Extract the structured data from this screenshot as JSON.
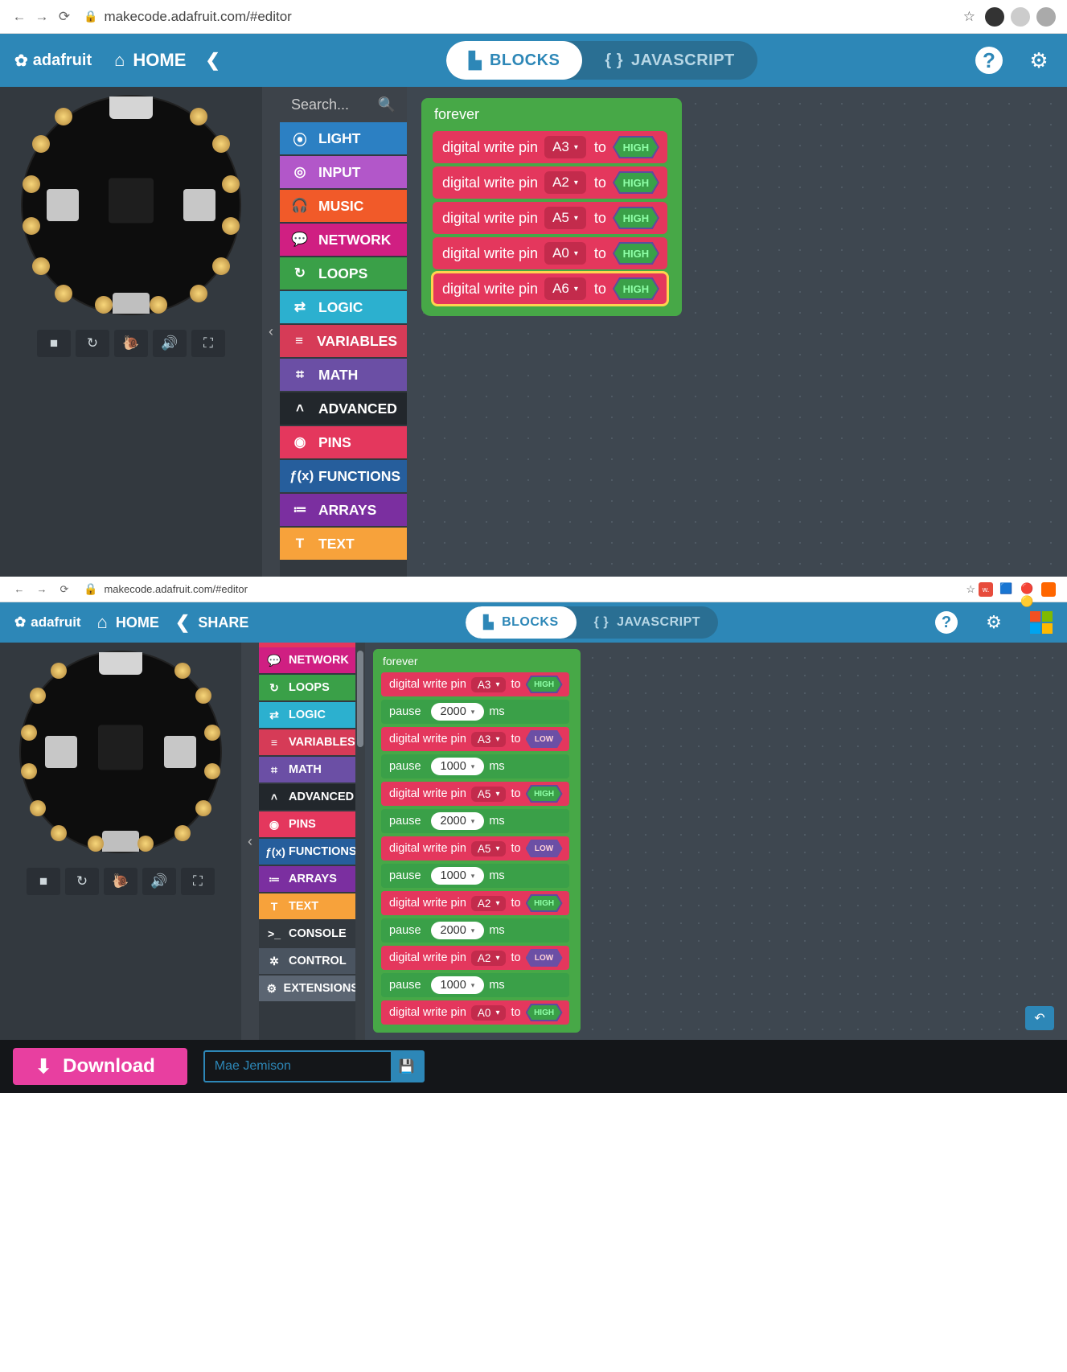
{
  "browser": {
    "url": "makecode.adafruit.com/#editor"
  },
  "app": {
    "logo": "adafruit",
    "home": "HOME",
    "share": "SHARE",
    "modes": {
      "blocks": "BLOCKS",
      "js": "JAVASCRIPT"
    }
  },
  "search": {
    "placeholder": "Search..."
  },
  "categories_top": [
    {
      "label": "LIGHT",
      "color": "#2c80c3",
      "icon": "grid-icon"
    },
    {
      "label": "INPUT",
      "color": "#b257c9",
      "icon": "target-icon"
    },
    {
      "label": "MUSIC",
      "color": "#f15a29",
      "icon": "headphones-icon"
    },
    {
      "label": "NETWORK",
      "color": "#d01f82",
      "icon": "chat-icon"
    },
    {
      "label": "LOOPS",
      "color": "#3aa048",
      "icon": "refresh-icon"
    },
    {
      "label": "LOGIC",
      "color": "#2cb0cf",
      "icon": "shuffle-icon"
    },
    {
      "label": "VARIABLES",
      "color": "#d63b57",
      "icon": "list-icon"
    },
    {
      "label": "MATH",
      "color": "#6b4fa5",
      "icon": "calculator-icon"
    },
    {
      "label": "ADVANCED",
      "color": "#22272c",
      "icon": "chevron-up-icon",
      "divider": true
    },
    {
      "label": "PINS",
      "color": "#e4375d",
      "icon": "disc-icon"
    },
    {
      "label": "FUNCTIONS",
      "color": "#265e9c",
      "icon": "fx-icon"
    },
    {
      "label": "ARRAYS",
      "color": "#7b2fa0",
      "icon": "array-icon"
    },
    {
      "label": "TEXT",
      "color": "#f7a23b",
      "icon": "text-icon"
    }
  ],
  "categories_bot": [
    {
      "label": "NETWORK",
      "color": "#d01f82",
      "icon": "chat-icon"
    },
    {
      "label": "LOOPS",
      "color": "#3aa048",
      "icon": "refresh-icon"
    },
    {
      "label": "LOGIC",
      "color": "#2cb0cf",
      "icon": "shuffle-icon"
    },
    {
      "label": "VARIABLES",
      "color": "#d63b57",
      "icon": "list-icon"
    },
    {
      "label": "MATH",
      "color": "#6b4fa5",
      "icon": "calculator-icon"
    },
    {
      "label": "ADVANCED",
      "color": "#22272c",
      "icon": "chevron-up-icon",
      "divider": true
    },
    {
      "label": "PINS",
      "color": "#e4375d",
      "icon": "disc-icon"
    },
    {
      "label": "FUNCTIONS",
      "color": "#265e9c",
      "icon": "fx-icon"
    },
    {
      "label": "ARRAYS",
      "color": "#7b2fa0",
      "icon": "array-icon"
    },
    {
      "label": "TEXT",
      "color": "#f7a23b",
      "icon": "text-icon"
    },
    {
      "label": "CONSOLE",
      "color": "#33393f",
      "icon": "terminal-icon"
    },
    {
      "label": "CONTROL",
      "color": "#4a5460",
      "icon": "gears-icon"
    },
    {
      "label": "EXTENSIONS",
      "color": "#5b6572",
      "icon": "gear-icon"
    }
  ],
  "block_labels": {
    "forever": "forever",
    "digital_write": "digital write pin",
    "to": "to",
    "pause": "pause",
    "ms": "ms",
    "HIGH": "HIGH",
    "LOW": "LOW"
  },
  "program_top": {
    "container": "forever",
    "statements": [
      {
        "type": "dwrite",
        "pin": "A3",
        "value": "HIGH",
        "selected": false
      },
      {
        "type": "dwrite",
        "pin": "A2",
        "value": "HIGH",
        "selected": false
      },
      {
        "type": "dwrite",
        "pin": "A5",
        "value": "HIGH",
        "selected": false
      },
      {
        "type": "dwrite",
        "pin": "A0",
        "value": "HIGH",
        "selected": false
      },
      {
        "type": "dwrite",
        "pin": "A6",
        "value": "HIGH",
        "selected": true
      }
    ]
  },
  "program_bot": {
    "container": "forever",
    "statements": [
      {
        "type": "dwrite",
        "pin": "A3",
        "value": "HIGH"
      },
      {
        "type": "pause",
        "ms": "2000"
      },
      {
        "type": "dwrite",
        "pin": "A3",
        "value": "LOW"
      },
      {
        "type": "pause",
        "ms": "1000"
      },
      {
        "type": "dwrite",
        "pin": "A5",
        "value": "HIGH"
      },
      {
        "type": "pause",
        "ms": "2000"
      },
      {
        "type": "dwrite",
        "pin": "A5",
        "value": "LOW"
      },
      {
        "type": "pause",
        "ms": "1000"
      },
      {
        "type": "dwrite",
        "pin": "A2",
        "value": "HIGH"
      },
      {
        "type": "pause",
        "ms": "2000"
      },
      {
        "type": "dwrite",
        "pin": "A2",
        "value": "LOW"
      },
      {
        "type": "pause",
        "ms": "1000"
      },
      {
        "type": "dwrite",
        "pin": "A0",
        "value": "HIGH"
      }
    ]
  },
  "footer": {
    "download": "Download",
    "project_placeholder": "Mae Jemison"
  },
  "icon_glyphs": {
    "grid-icon": "⦿",
    "target-icon": "◎",
    "headphones-icon": "🎧",
    "chat-icon": "💬",
    "refresh-icon": "↻",
    "shuffle-icon": "⇄",
    "list-icon": "≡",
    "calculator-icon": "⌗",
    "chevron-up-icon": "˄",
    "disc-icon": "◉",
    "fx-icon": "ƒ(x)",
    "array-icon": "≔",
    "text-icon": "T",
    "terminal-icon": ">_",
    "gears-icon": "✲",
    "gear-icon": "⚙",
    "home-icon": "⌂",
    "share-icon": "❮",
    "help-icon": "?",
    "settings-icon": "⚙",
    "blocks-icon": "▙",
    "js-icon": "{ }",
    "search-icon": "🔍",
    "stop-icon": "■",
    "restart-icon": "↻",
    "debug-icon": "🐌",
    "mute-icon": "🔊",
    "fullscreen-icon": "⛶",
    "download-icon": "⬇",
    "save-icon": "💾",
    "undo-icon": "↶",
    "chevron-left-icon": "‹"
  },
  "pad_positions": [
    {
      "t": 14,
      "l": 40
    },
    {
      "t": 14,
      "l": 208
    },
    {
      "t": 48,
      "l": 12
    },
    {
      "t": 48,
      "l": 236
    },
    {
      "t": 98,
      "l": 0
    },
    {
      "t": 98,
      "l": 248
    },
    {
      "t": 150,
      "l": 0
    },
    {
      "t": 150,
      "l": 248
    },
    {
      "t": 200,
      "l": 12
    },
    {
      "t": 200,
      "l": 236
    },
    {
      "t": 234,
      "l": 40
    },
    {
      "t": 234,
      "l": 208
    },
    {
      "t": 248,
      "l": 90
    },
    {
      "t": 248,
      "l": 158
    }
  ]
}
